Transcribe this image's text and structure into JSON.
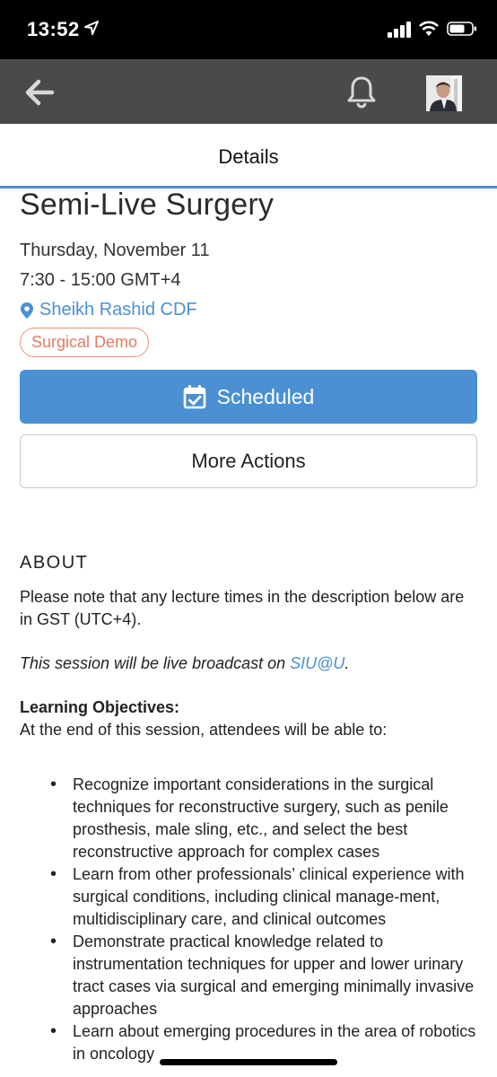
{
  "status": {
    "time": "13:52"
  },
  "header": {
    "title": "Details"
  },
  "event": {
    "title": "Semi-Live Surgery",
    "date": "Thursday, November 11",
    "time": "7:30 - 15:00 GMT+4",
    "location": "Sheikh Rashid CDF",
    "tag": "Surgical Demo"
  },
  "actions": {
    "scheduled_label": "Scheduled",
    "more_label": "More Actions"
  },
  "about": {
    "heading": "ABOUT",
    "note": "Please note that any lecture times in the description below are in GST (UTC+4).",
    "broadcast_prefix": "This session will be live broadcast on ",
    "broadcast_link": "SIU@U",
    "broadcast_suffix": ".",
    "objectives_heading": "Learning Objectives:",
    "objectives_intro": "At the end of this session, attendees will be able to:",
    "objectives": [
      "Recognize important considerations in the surgical techniques for reconstructive surgery, such as penile prosthesis, male sling, etc., and select the best reconstructive approach for complex cases",
      "Learn from other professionals’ clinical experience with surgical conditions, including clinical manage-ment, multidisciplinary care, and clinical outcomes",
      "Demonstrate practical knowledge related to instrumentation techniques for upper and lower urinary tract cases via surgical and emerging minimally invasive approaches",
      "Learn about emerging procedures in the area of robotics in oncology"
    ]
  },
  "colors": {
    "accent": "#4a90d2",
    "tag": "#e07a63",
    "navbar": "#4a4a4a"
  }
}
